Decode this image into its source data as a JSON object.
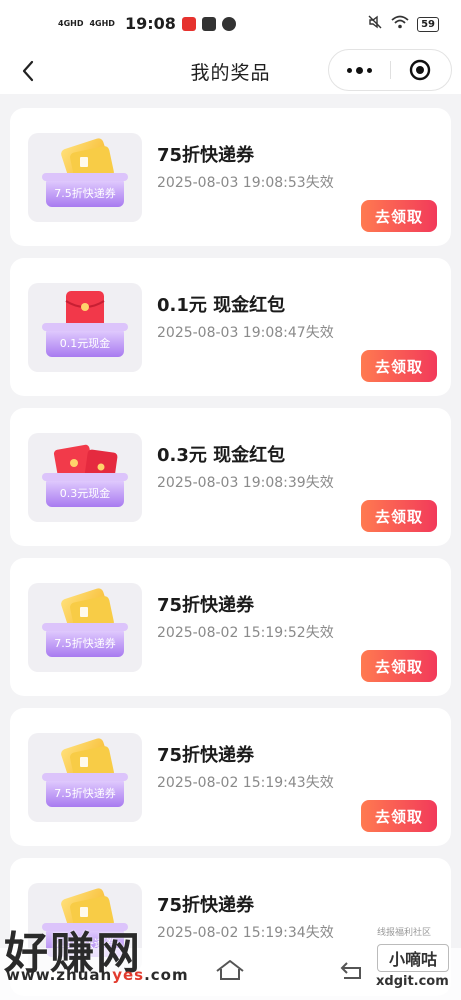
{
  "status_bar": {
    "signal_1": "4GHD",
    "signal_2": "4GHD",
    "time": "19:08",
    "battery": "59"
  },
  "nav": {
    "title": "我的奖品"
  },
  "prizes": [
    {
      "name": "75折快递券",
      "thumb_label": "7.5折快递券",
      "expiry": "2025-08-03 19:08:53失效",
      "button": "去领取"
    },
    {
      "name": "0.1元 现金红包",
      "thumb_label": "0.1元现金",
      "expiry": "2025-08-03 19:08:47失效",
      "button": "去领取"
    },
    {
      "name": "0.3元 现金红包",
      "thumb_label": "0.3元现金",
      "expiry": "2025-08-03 19:08:39失效",
      "button": "去领取"
    },
    {
      "name": "75折快递券",
      "thumb_label": "7.5折快递券",
      "expiry": "2025-08-02 15:19:52失效",
      "button": "去领取"
    },
    {
      "name": "75折快递券",
      "thumb_label": "7.5折快递券",
      "expiry": "2025-08-02 15:19:43失效",
      "button": "去领取"
    },
    {
      "name": "75折快递券",
      "thumb_label": "7.5折快递券",
      "expiry": "2025-08-02 15:19:34失效",
      "button": "去领取"
    }
  ],
  "watermark": {
    "brand": "好赚网",
    "url_prefix": "www.zhuan",
    "url_accent": "yes",
    "url_suffix": ".com",
    "box_text": "小嘀咕",
    "box_sub": "线报福利社区",
    "url2": "xdgit.com"
  },
  "colors": {
    "accent_gradient_start": "#ff7a50",
    "accent_gradient_end": "#f23a5a",
    "coupon_gold": "#f7c23a",
    "envelope_red": "#f23a4a",
    "box_purple": "#b98cf5"
  }
}
